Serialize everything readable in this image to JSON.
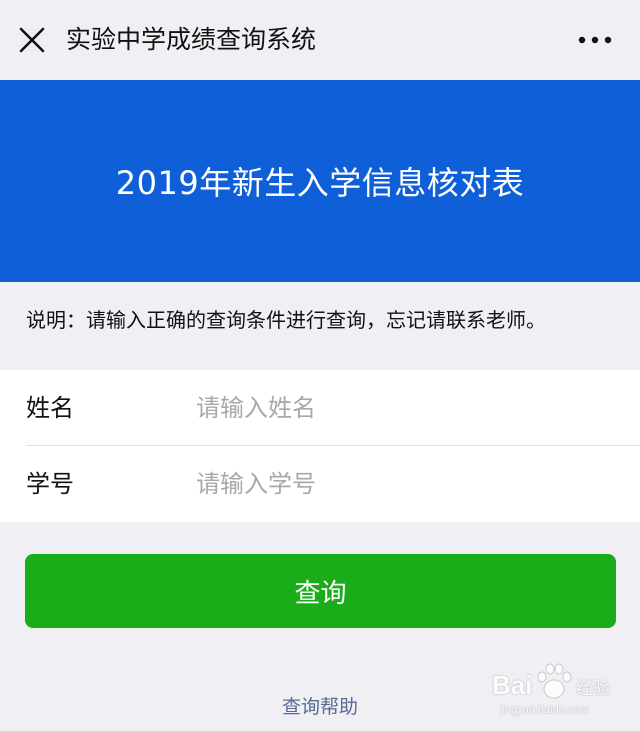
{
  "nav": {
    "title": "实验中学成绩查询系统",
    "close_icon": "close-icon",
    "more_icon": "more-dots-icon"
  },
  "banner": {
    "title": "2019年新生入学信息核对表",
    "color": "#0f5fd8"
  },
  "notice": "说明：请输入正确的查询条件进行查询，忘记请联系老师。",
  "form": {
    "fields": [
      {
        "label": "姓名",
        "value": "",
        "placeholder": "请输入姓名"
      },
      {
        "label": "学号",
        "value": "",
        "placeholder": "请输入学号"
      }
    ]
  },
  "submit_label": "查询",
  "submit_color": "#1aad19",
  "help_label": "查询帮助",
  "help_color": "#576b95",
  "watermark": {
    "brand": "Bai",
    "brand_suffix": "经验",
    "url": "jingyan.baidu.com",
    "paw_icon": "baidu-paw-icon"
  }
}
